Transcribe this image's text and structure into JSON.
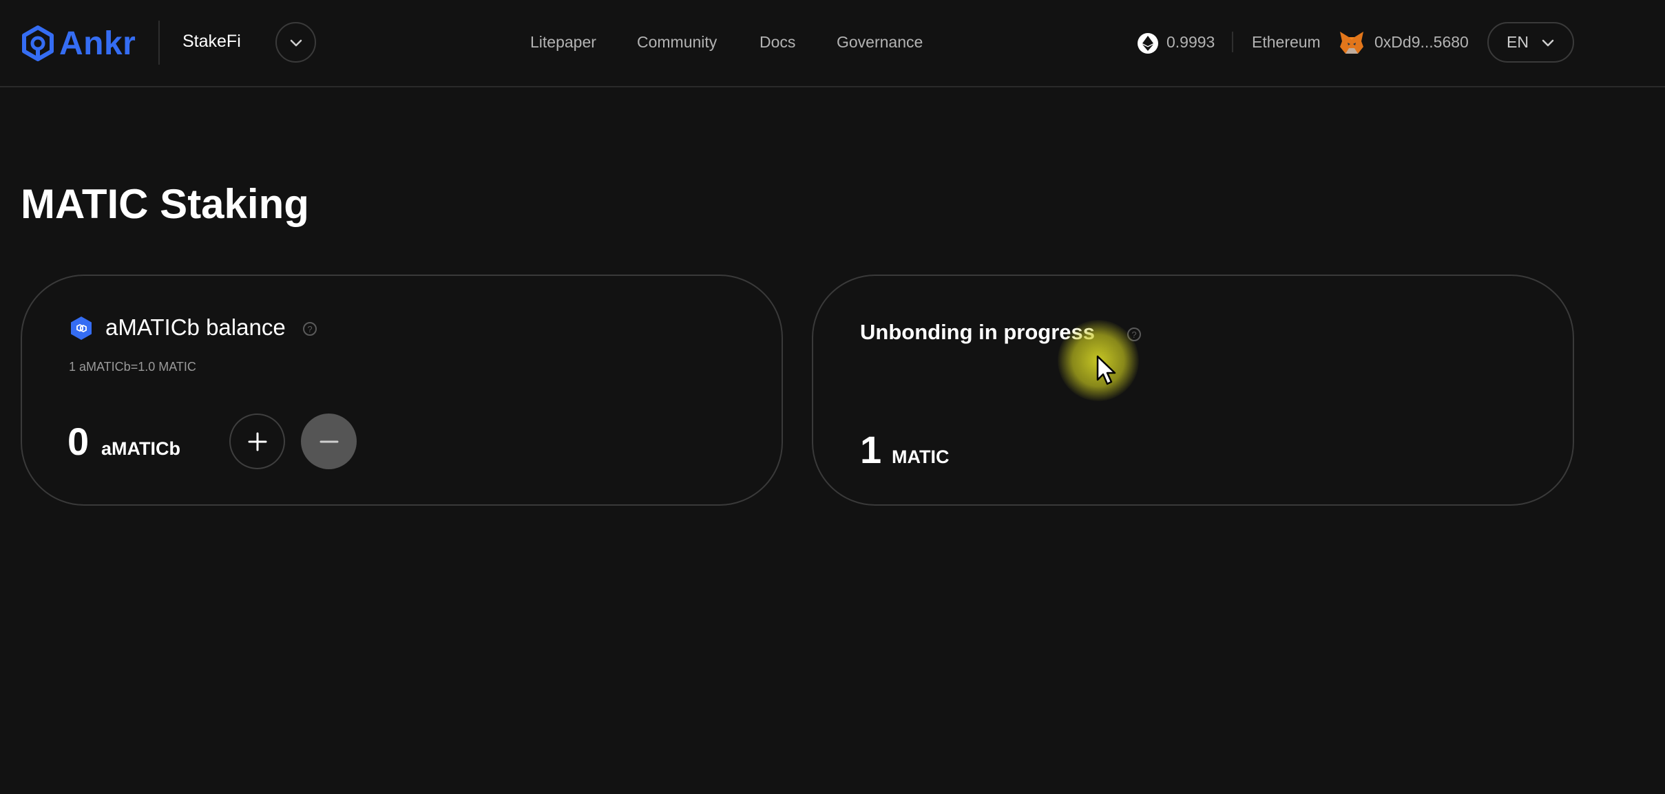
{
  "header": {
    "logo_text": "Ankr",
    "product": "StakeFi",
    "nav": [
      "Litepaper",
      "Community",
      "Docs",
      "Governance"
    ],
    "eth_balance": "0.9993",
    "network": "Ethereum",
    "address": "0xDd9...5680",
    "language": "EN"
  },
  "page": {
    "title": "MATIC Staking"
  },
  "balance_card": {
    "title": "aMATICb balance",
    "help": "?",
    "rate": "1 aMATICb=1.0 MATIC",
    "amount": "0",
    "unit": "aMATICb"
  },
  "unbonding_card": {
    "title": "Unbonding in progress",
    "help": "?",
    "amount": "1",
    "unit": "MATIC"
  },
  "colors": {
    "background": "#121212",
    "brand": "#356df3",
    "text_muted": "#b3b3b3",
    "card_border": "#3a3a3a",
    "cursor_highlight": "#e6e628"
  },
  "icons": [
    "ankr-logo-icon",
    "chevron-down-icon",
    "ethereum-icon",
    "metamask-fox-icon",
    "matic-token-icon",
    "help-icon",
    "plus-icon",
    "minus-icon",
    "mouse-cursor-icon"
  ]
}
